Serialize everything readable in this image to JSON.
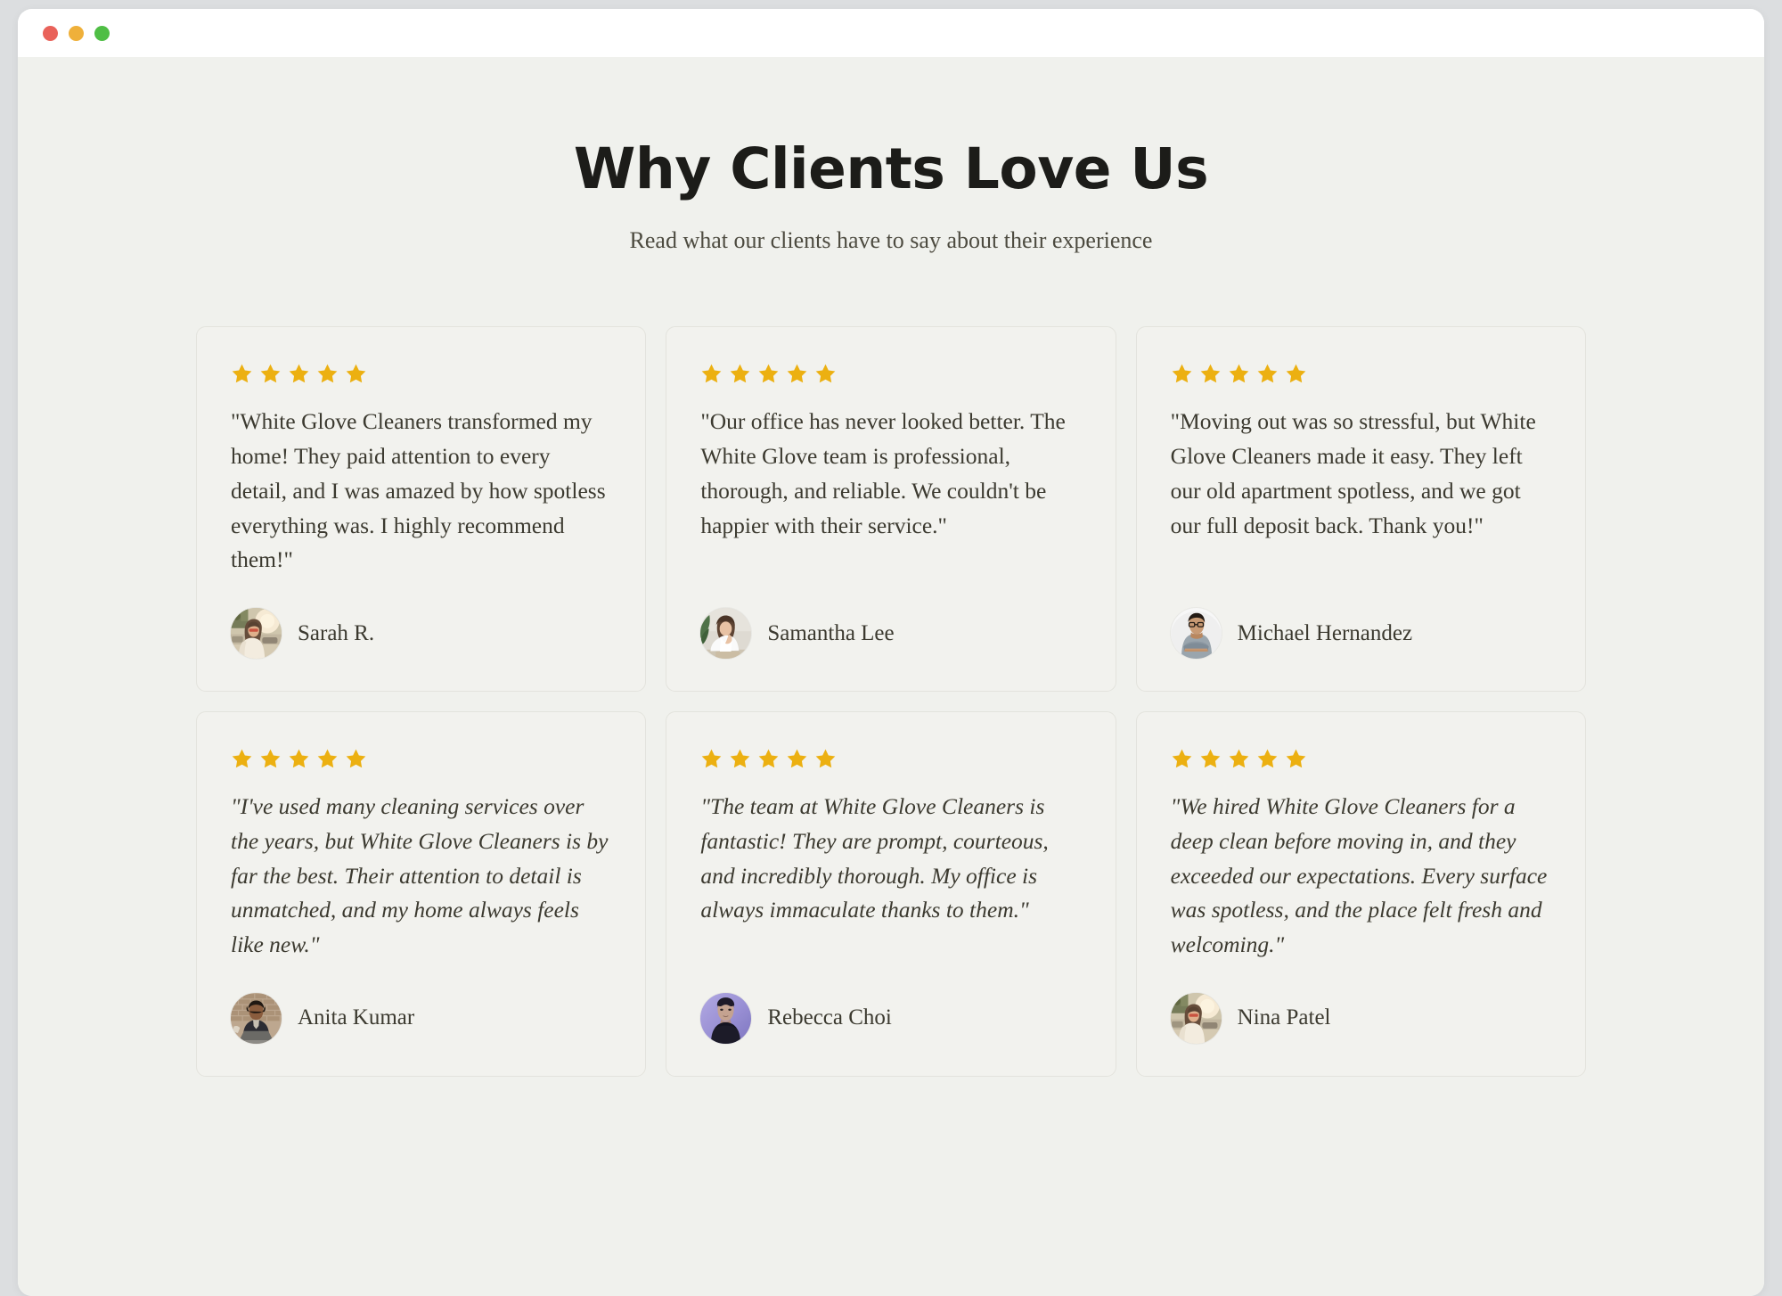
{
  "window": {
    "traffic_lights": [
      {
        "name": "close",
        "color": "#e9625a"
      },
      {
        "name": "minimize",
        "color": "#efb03a"
      },
      {
        "name": "maximize",
        "color": "#4fbe45"
      }
    ]
  },
  "section": {
    "title": "Why Clients Love Us",
    "subtitle": "Read what our clients have to say about their experience"
  },
  "theme": {
    "page_background": "#f0f1ed",
    "card_background": "#f2f2ee",
    "card_border": "#e3e3dd",
    "text_color": "#3c3a30",
    "title_color": "#1c1c19",
    "star_color": "#ecb011"
  },
  "testimonials": [
    {
      "rating": 5,
      "stars_label": "5 out of 5 stars",
      "quote": "\"White Glove Cleaners transformed my home! They paid attention to every detail, and I was amazed by how spotless everything was. I highly recommend them!\"",
      "italic": false,
      "author": "Sarah R.",
      "avatar": "woman-sunglasses-street-photo"
    },
    {
      "rating": 5,
      "stars_label": "5 out of 5 stars",
      "quote": "\"Our office has never looked better. The White Glove team is professional, thorough, and reliable. We couldn't be happier with their service.\"",
      "italic": false,
      "author": "Samantha Lee",
      "avatar": "woman-white-top-plant-photo"
    },
    {
      "rating": 5,
      "stars_label": "5 out of 5 stars",
      "quote": "\"Moving out was so stressful, but White Glove Cleaners made it easy. They left our old apartment spotless, and we got our full deposit back. Thank you!\"",
      "italic": false,
      "author": "Michael Hernandez",
      "avatar": "man-glasses-gray-shirt-photo"
    },
    {
      "rating": 5,
      "stars_label": "5 out of 5 stars",
      "quote": "\"I've used many cleaning services over the years, but White Glove Cleaners is by far the best. Their attention to detail is unmatched, and my home always feels like new.\"",
      "italic": true,
      "author": "Anita Kumar",
      "avatar": "woman-laptop-brick-wall-photo"
    },
    {
      "rating": 5,
      "stars_label": "5 out of 5 stars",
      "quote": "\"The team at White Glove Cleaners is fantastic! They are prompt, courteous, and incredibly thorough. My office is always immaculate thanks to them.\"",
      "italic": true,
      "author": "Rebecca Choi",
      "avatar": "woman-purple-background-portrait-photo"
    },
    {
      "rating": 5,
      "stars_label": "5 out of 5 stars",
      "quote": "\"We hired White Glove Cleaners for a deep clean before moving in, and they exceeded our expectations. Every surface was spotless, and the place felt fresh and welcoming.\"",
      "italic": true,
      "author": "Nina Patel",
      "avatar": "woman-sunglasses-street-photo"
    }
  ]
}
